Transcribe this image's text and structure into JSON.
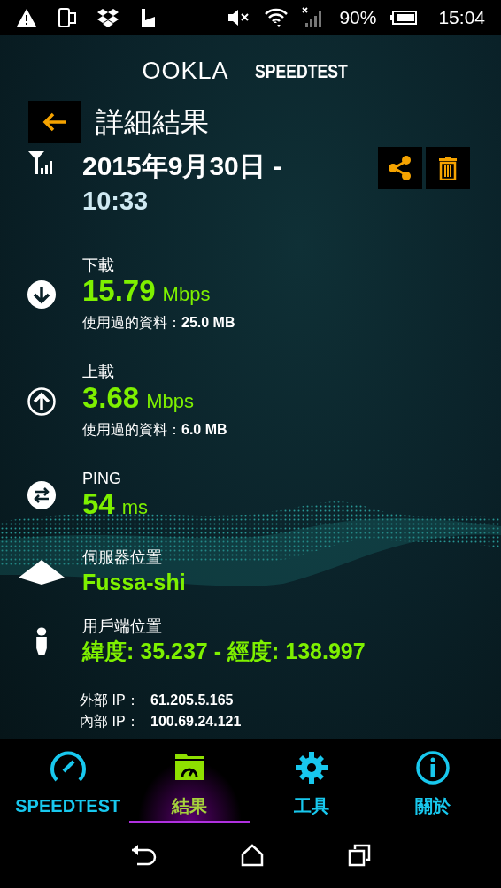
{
  "status_bar": {
    "battery": "90%",
    "time": "15:04"
  },
  "logo": {
    "brand": "OOKLA",
    "product": "SPEEDTEST"
  },
  "header": {
    "title": "詳細結果"
  },
  "result": {
    "date": "2015年9月30日 -",
    "time": "10:33"
  },
  "metrics": [
    {
      "kind": "download",
      "label": "下載",
      "value": "15.79",
      "unit": "Mbps",
      "data_used": "使用過的資料：**25.0 MB**"
    },
    {
      "kind": "upload",
      "label": "上載",
      "value": "3.68",
      "unit": "Mbps",
      "data_used": "使用過的資料：**6.0 MB**"
    },
    {
      "kind": "ping",
      "label": "PING",
      "value": "54",
      "unit": "ms"
    },
    {
      "kind": "server",
      "label": "伺服器位置",
      "value": "Fussa-shi"
    },
    {
      "kind": "client",
      "label": "用戶端位置",
      "value": "緯度: 35.237 - 經度: 138.997"
    }
  ],
  "ip": [
    {
      "label": "外部 IP：",
      "value": "61.205.5.165"
    },
    {
      "label": "內部 IP：",
      "value": "100.69.24.121"
    }
  ],
  "tabs": [
    {
      "label": "SPEEDTEST",
      "selected": false
    },
    {
      "label": "結果",
      "selected": true
    },
    {
      "label": "工具",
      "selected": false
    },
    {
      "label": "關於",
      "selected": false
    }
  ]
}
